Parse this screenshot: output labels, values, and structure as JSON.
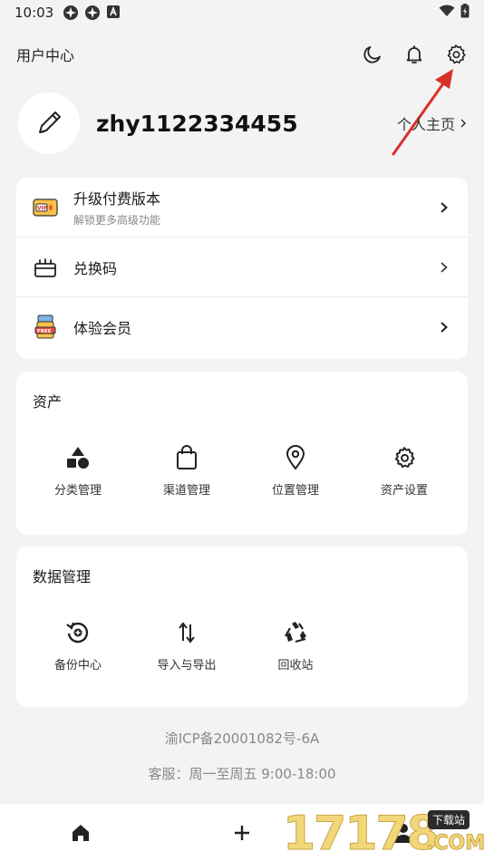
{
  "status_bar": {
    "time": "10:03"
  },
  "header": {
    "title": "用户中心"
  },
  "profile": {
    "username": "zhy1122334455",
    "homepage_label": "个人主页"
  },
  "menu": [
    {
      "icon": "vip-ticket-icon",
      "label": "升级付费版本",
      "sub": "解锁更多高级功能"
    },
    {
      "icon": "gift-box-icon",
      "label": "兑换码",
      "sub": ""
    },
    {
      "icon": "free-gift-icon",
      "label": "体验会员",
      "sub": ""
    }
  ],
  "assets": {
    "title": "资产",
    "items": [
      {
        "icon": "shapes-icon",
        "label": "分类管理"
      },
      {
        "icon": "shopping-bag-icon",
        "label": "渠道管理"
      },
      {
        "icon": "location-pin-icon",
        "label": "位置管理"
      },
      {
        "icon": "gear-icon",
        "label": "资产设置"
      }
    ]
  },
  "data_mgmt": {
    "title": "数据管理",
    "items": [
      {
        "icon": "backup-icon",
        "label": "备份中心"
      },
      {
        "icon": "import-export-icon",
        "label": "导入与导出"
      },
      {
        "icon": "recycle-icon",
        "label": "回收站"
      }
    ]
  },
  "footer": {
    "icp": "渝ICP备20001082号-6A",
    "service": "客服：周一至周五 9:00-18:00"
  },
  "bottom_nav": [
    {
      "icon": "home-icon"
    },
    {
      "icon": "plus-icon"
    },
    {
      "icon": "person-icon"
    }
  ],
  "watermark": {
    "number": "17178",
    "tag": "下载站",
    "domain": ".COM"
  },
  "colors": {
    "background": "#f3f3f3",
    "card": "#ffffff",
    "annotation_arrow": "#d9302a"
  }
}
